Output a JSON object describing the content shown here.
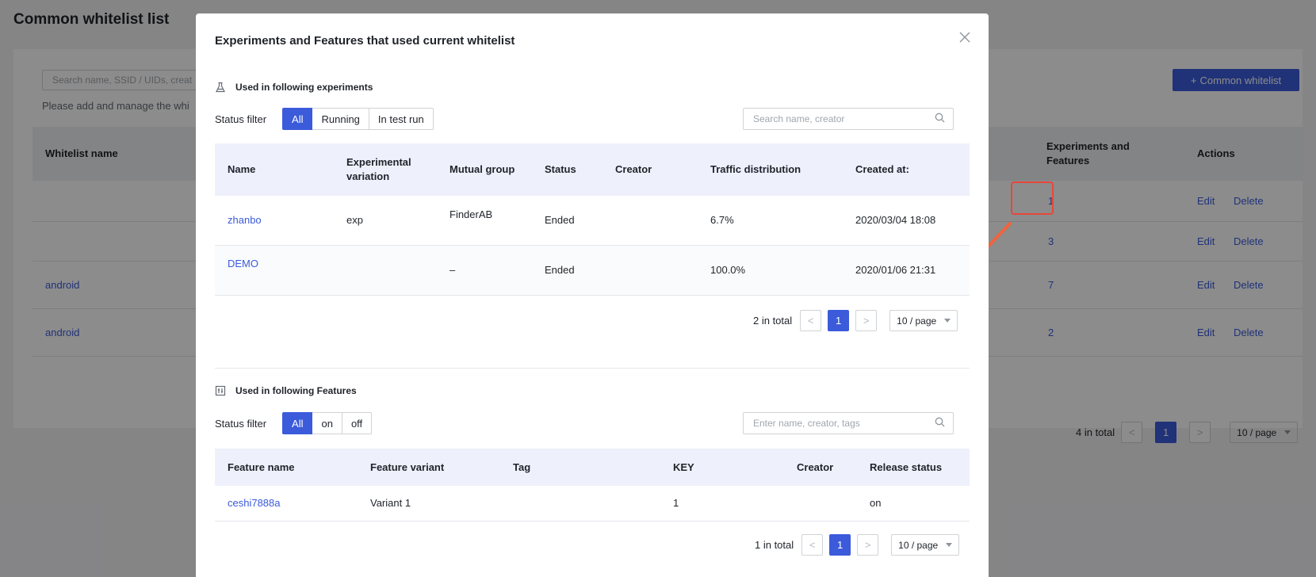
{
  "background": {
    "title": "Common whitelist list",
    "search_placeholder": "Search name, SSID / UIDs, creat",
    "hint": "Please add and manage the whi",
    "add_button": "Common whitelist",
    "columns": {
      "name": "Whitelist name",
      "exp_features": "Experiments and Features",
      "actions": "Actions"
    },
    "rows": [
      {
        "name": "",
        "count": "1",
        "edit": "Edit",
        "delete": "Delete"
      },
      {
        "name": "",
        "count": "3",
        "edit": "Edit",
        "delete": "Delete"
      },
      {
        "name": "android",
        "count": "7",
        "edit": "Edit",
        "delete": "Delete"
      },
      {
        "name": "android",
        "count": "2",
        "edit": "Edit",
        "delete": "Delete"
      }
    ],
    "pager": {
      "total": "4 in total",
      "current": "1",
      "size": "10 / page"
    }
  },
  "modal": {
    "title": "Experiments and Features that used current whitelist",
    "experiments": {
      "heading": "Used in following experiments",
      "filter_label": "Status filter",
      "filters": [
        "All",
        "Running",
        "In test run"
      ],
      "active_filter": "All",
      "search_placeholder": "Search name, creator",
      "columns": [
        "Name",
        "Experimental variation",
        "Mutual group",
        "Status",
        "Creator",
        "Traffic distribution",
        "Created at:"
      ],
      "rows": [
        {
          "name": "zhanbo",
          "variation": "exp",
          "group": "FinderAB",
          "status": "Ended",
          "creator": "",
          "traffic": "6.7%",
          "created": "2020/03/04 18:08"
        },
        {
          "name": "DEMO",
          "variation": "",
          "group": "–",
          "status": "Ended",
          "creator": "",
          "traffic": "100.0%",
          "created": "2020/01/06 21:31"
        }
      ],
      "pager": {
        "total": "2 in total",
        "current": "1",
        "size": "10 / page"
      }
    },
    "features": {
      "heading": "Used in following Features",
      "filter_label": "Status filter",
      "filters": [
        "All",
        "on",
        "off"
      ],
      "active_filter": "All",
      "search_placeholder": "Enter name, creator, tags",
      "columns": [
        "Feature name",
        "Feature variant",
        "Tag",
        "KEY",
        "Creator",
        "Release status"
      ],
      "rows": [
        {
          "name": "ceshi7888a",
          "variant": "Variant 1",
          "tag": "",
          "key": "1",
          "creator": "",
          "release": "on"
        }
      ],
      "pager": {
        "total": "1 in total",
        "current": "1",
        "size": "10 / page"
      }
    }
  },
  "colors": {
    "primary": "#3b5bdb",
    "highlight": "#e8473a",
    "arrow": "#f0643c"
  },
  "icons": {
    "close": "close-icon",
    "experiment": "flask-icon",
    "feature": "feature-toggle-icon",
    "search": "search-icon",
    "add": "plus-icon"
  }
}
